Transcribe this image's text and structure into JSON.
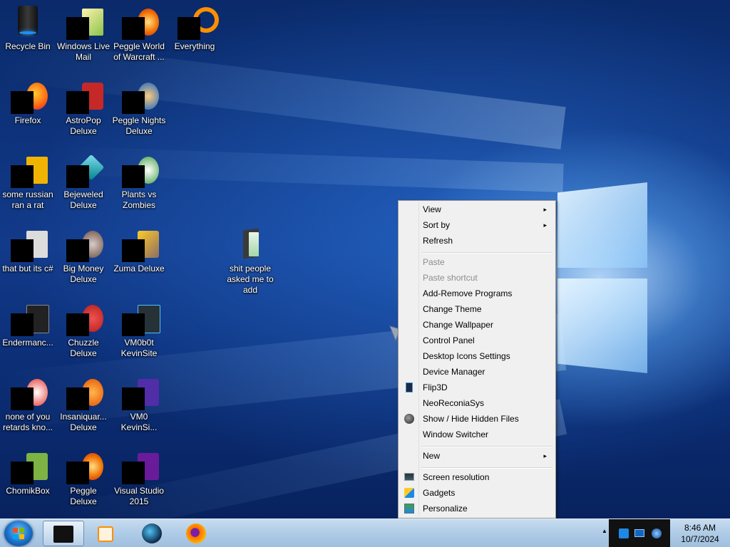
{
  "desktop": {
    "icons": [
      {
        "label": "Recycle Bin"
      },
      {
        "label": "Windows Live Mail"
      },
      {
        "label": "Peggle World of Warcraft ..."
      },
      {
        "label": "Everything"
      },
      {
        "label": "Firefox"
      },
      {
        "label": "AstroPop Deluxe"
      },
      {
        "label": "Peggle Nights Deluxe"
      },
      {
        "label": "some russian ran a rat"
      },
      {
        "label": "Bejeweled Deluxe"
      },
      {
        "label": "Plants vs Zombies"
      },
      {
        "label": "that but its c#"
      },
      {
        "label": "Big Money Deluxe"
      },
      {
        "label": "Zuma Deluxe"
      },
      {
        "label": "shit people asked me to add"
      },
      {
        "label": "Endermanc..."
      },
      {
        "label": "Chuzzle Deluxe"
      },
      {
        "label": "VM0b0t KevinSite"
      },
      {
        "label": "none of you retards kno..."
      },
      {
        "label": "Insaniquar... Deluxe"
      },
      {
        "label": "VM0 KevinSi..."
      },
      {
        "label": "ChomikBox"
      },
      {
        "label": "Peggle Deluxe"
      },
      {
        "label": "Visual Studio 2015"
      }
    ]
  },
  "context_menu": {
    "items": [
      {
        "label": "View"
      },
      {
        "label": "Sort by"
      },
      {
        "label": "Refresh"
      },
      {
        "label": "Paste"
      },
      {
        "label": "Paste shortcut"
      },
      {
        "label": "Add-Remove Programs"
      },
      {
        "label": "Change Theme"
      },
      {
        "label": "Change Wallpaper"
      },
      {
        "label": "Control Panel"
      },
      {
        "label": "Desktop Icons Settings"
      },
      {
        "label": "Device Manager"
      },
      {
        "label": "Flip3D"
      },
      {
        "label": "NeoReconiaSys"
      },
      {
        "label": "Show / Hide Hidden Files"
      },
      {
        "label": "Window Switcher"
      },
      {
        "label": "New"
      },
      {
        "label": "Screen resolution"
      },
      {
        "label": "Gadgets"
      },
      {
        "label": "Personalize"
      }
    ],
    "submenu_arrow": "▸"
  },
  "taskbar": {
    "clock_time": "8:46 AM",
    "clock_date": "10/7/2024",
    "tray_expand": "▲"
  }
}
